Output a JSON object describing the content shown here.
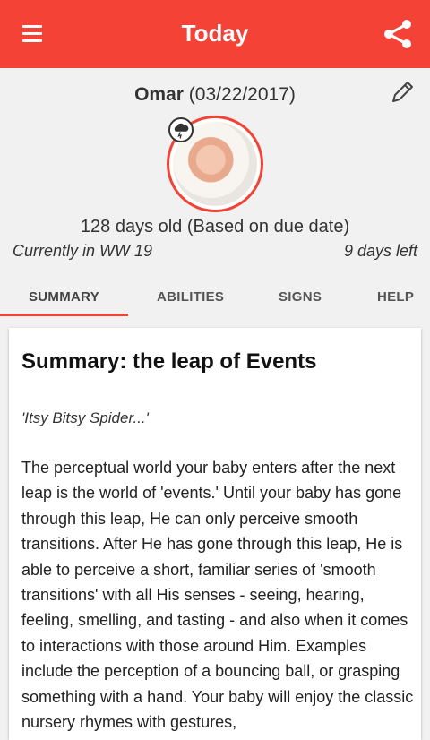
{
  "appbar": {
    "title": "Today",
    "menu_icon": "hamburger-menu-icon",
    "share_icon": "share-icon"
  },
  "profile": {
    "name": "Omar",
    "birthdate": "(03/22/2017)",
    "age_text": "128 days old (Based on due date)",
    "current_week": "Currently in WW 19",
    "days_left": "9 days left",
    "edit_icon": "pencil-icon",
    "weather_icon": "storm-cloud-icon"
  },
  "tabs": [
    {
      "label": "SUMMARY",
      "active": true
    },
    {
      "label": "ABILITIES",
      "active": false
    },
    {
      "label": "SIGNS",
      "active": false
    },
    {
      "label": "HELP",
      "active": false
    }
  ],
  "card": {
    "title": "Summary: the leap of Events",
    "quote": "'Itsy Bitsy Spider...'",
    "body": "The perceptual world your baby enters after the next leap is the world of 'events.' Until your baby has gone through this leap, He can only perceive smooth transitions. After He has gone through this leap, He is able to perceive a short, familiar series of 'smooth transitions' with all His senses - seeing, hearing, feeling, smelling, and tasting - and also when it comes to interactions with those around Him. Examples include the perception of a bouncing ball, or grasping something with a hand. Your baby will enjoy the classic nursery rhymes with gestures,"
  },
  "colors": {
    "accent": "#f44336",
    "background": "#f1f1f1",
    "card": "#ffffff"
  }
}
